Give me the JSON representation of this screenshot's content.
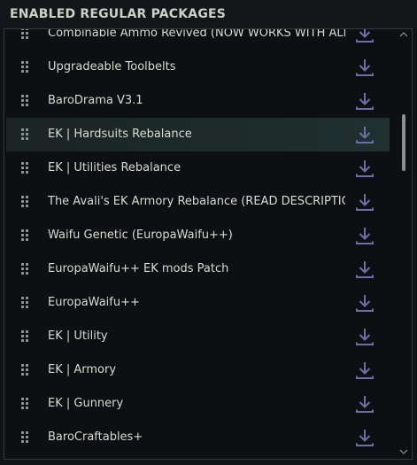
{
  "header": {
    "title": "ENABLED REGULAR PACKAGES"
  },
  "packages": [
    {
      "label": "Combinable Ammo Revived (NOW WORKS WITH ALL",
      "selected": false
    },
    {
      "label": "Upgradeable Toolbelts",
      "selected": false
    },
    {
      "label": "BaroDrama V3.1",
      "selected": false
    },
    {
      "label": "EK | Hardsuits Rebalance",
      "selected": true
    },
    {
      "label": "EK | Utilities Rebalance",
      "selected": false
    },
    {
      "label": "The Avali's EK Armory Rebalance (READ DESCRIPTIC",
      "selected": false
    },
    {
      "label": "Waifu Genetic (EuropaWaifu++)",
      "selected": false
    },
    {
      "label": "EuropaWaifu++ EK mods Patch",
      "selected": false
    },
    {
      "label": "EuropaWaifu++",
      "selected": false
    },
    {
      "label": "EK | Utility",
      "selected": false
    },
    {
      "label": "EK | Armory",
      "selected": false
    },
    {
      "label": "EK | Gunnery",
      "selected": false
    },
    {
      "label": "BaroCraftables+",
      "selected": false
    }
  ],
  "icons": {
    "row_grip": "drag-handle-icon",
    "row_action": "download-icon",
    "scroll_up": "scroll-up-arrow-icon",
    "scroll_down": "scroll-down-arrow-icon"
  },
  "colors": {
    "text": "#d8dccf",
    "header_text": "#cdd1c6",
    "download_icon": "#6e6fa8",
    "selected_row": "#1e2b2a"
  }
}
